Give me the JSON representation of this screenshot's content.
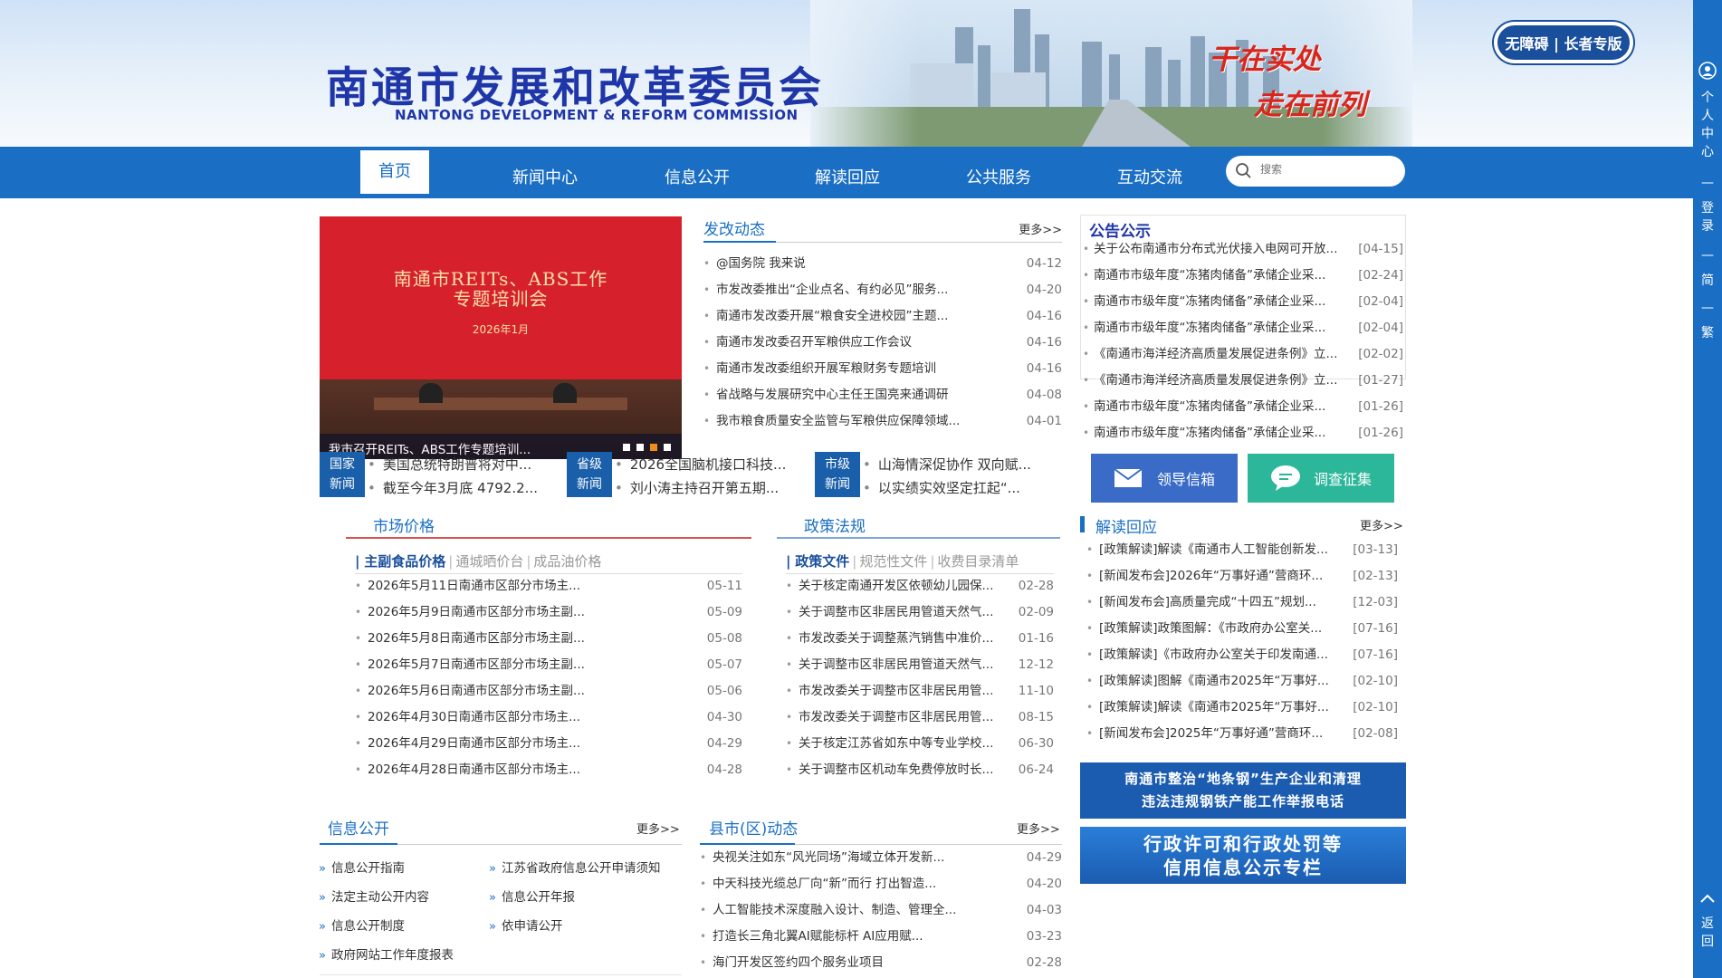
{
  "header": {
    "logo_cn": "南通市发展和改革委员会",
    "logo_en": "NANTONG DEVELOPMENT & REFORM COMMISSION",
    "slogan_line1": "干在实处",
    "slogan_line2": "走在前列",
    "accessibility": "无障碍 | 长者专版"
  },
  "right_bar": {
    "user_center": "个人中心",
    "login": "登录",
    "simplified": "简",
    "traditional": "繁",
    "back": "返回"
  },
  "nav": {
    "items": [
      "首页",
      "新闻中心",
      "信息公开",
      "解读回应",
      "公共服务",
      "互动交流"
    ],
    "search_placeholder": "搜索"
  },
  "carousel": {
    "screen_title_1": "南通市REITs、ABS工作",
    "screen_title_2": "专题培训会",
    "screen_year": "2026年1月",
    "caption": "我市召开REITs、ABS工作专题培训..."
  },
  "fagai": {
    "title": "发改动态",
    "more": "更多>>",
    "items": [
      {
        "t": "@国务院 我来说",
        "d": "04-12"
      },
      {
        "t": "市发改委推出“企业点名、有约必见”服务...",
        "d": "04-20"
      },
      {
        "t": "南通市发改委开展“粮食安全进校园”主题...",
        "d": "04-16"
      },
      {
        "t": "南通市发改委召开军粮供应工作会议",
        "d": "04-16"
      },
      {
        "t": "南通市发改委组织开展军粮财务专题培训",
        "d": "04-16"
      },
      {
        "t": "省战略与发展研究中心主任王国亮来通调研",
        "d": "04-08"
      },
      {
        "t": "我市粮食质量安全监管与军粮供应保障领域...",
        "d": "04-01"
      }
    ]
  },
  "news_strip": [
    {
      "tag1": "国家",
      "tag2": "新闻",
      "line1": "美国总统特朗普将对中...",
      "line2": "截至今年3月底 4792.2..."
    },
    {
      "tag1": "省级",
      "tag2": "新闻",
      "line1": "2026全国脑机接口科技...",
      "line2": "刘小涛主持召开第五期..."
    },
    {
      "tag1": "市级",
      "tag2": "新闻",
      "line1": "山海情深促协作 双向赋...",
      "line2": "以实绩实效坚定扛起“..."
    }
  ],
  "market": {
    "title": "市场价格",
    "tabs": [
      "主副食品价格",
      "通城晒价台",
      "成品油价格"
    ],
    "items": [
      {
        "t": "2026年5月11日南通市区部分市场主...",
        "d": "05-11"
      },
      {
        "t": "2026年5月9日南通市区部分市场主副...",
        "d": "05-09"
      },
      {
        "t": "2026年5月8日南通市区部分市场主副...",
        "d": "05-08"
      },
      {
        "t": "2026年5月7日南通市区部分市场主副...",
        "d": "05-07"
      },
      {
        "t": "2026年5月6日南通市区部分市场主副...",
        "d": "05-06"
      },
      {
        "t": "2026年4月30日南通市区部分市场主...",
        "d": "04-30"
      },
      {
        "t": "2026年4月29日南通市区部分市场主...",
        "d": "04-29"
      },
      {
        "t": "2026年4月28日南通市区部分市场主...",
        "d": "04-28"
      }
    ]
  },
  "policy": {
    "title": "政策法规",
    "tabs": [
      "政策文件",
      "规范性文件",
      "收费目录清单"
    ],
    "items": [
      {
        "t": "关于核定南通开发区依顿幼儿园保...",
        "d": "02-28"
      },
      {
        "t": "关于调整市区非居民用管道天然气...",
        "d": "02-09"
      },
      {
        "t": "市发改委关于调整蒸汽销售中准价...",
        "d": "01-16"
      },
      {
        "t": "关于调整市区非居民用管道天然气...",
        "d": "12-12"
      },
      {
        "t": "市发改委关于调整市区非居民用管...",
        "d": "11-10"
      },
      {
        "t": "市发改委关于调整市区非居民用管...",
        "d": "08-15"
      },
      {
        "t": "关于核定江苏省如东中等专业学校...",
        "d": "06-30"
      },
      {
        "t": "关于调整市区机动车免费停放时长...",
        "d": "06-24"
      }
    ]
  },
  "notice": {
    "title": "公告公示",
    "items": [
      {
        "t": "关于公布南通市分布式光伏接入电网可开放...",
        "d": "[04-15]"
      },
      {
        "t": "南通市市级年度“冻猪肉储备”承储企业采...",
        "d": "[02-24]"
      },
      {
        "t": "南通市市级年度“冻猪肉储备”承储企业采...",
        "d": "[02-04]"
      },
      {
        "t": "南通市市级年度“冻猪肉储备”承储企业采...",
        "d": "[02-04]"
      },
      {
        "t": "《南通市海洋经济高质量发展促进条例》立...",
        "d": "[02-02]"
      },
      {
        "t": "《南通市海洋经济高质量发展促进条例》立...",
        "d": "[01-27]"
      },
      {
        "t": "南通市市级年度“冻猪肉储备”承储企业采...",
        "d": "[01-26]"
      },
      {
        "t": "南通市市级年度“冻猪肉储备”承储企业采...",
        "d": "[01-26]"
      }
    ]
  },
  "buttons": {
    "leader_mail": "领导信箱",
    "survey": "调查征集"
  },
  "interpret": {
    "title": "解读回应",
    "more": "更多>>",
    "items": [
      {
        "t": "[政策解读]解读《南通市人工智能创新发...",
        "d": "[03-13]"
      },
      {
        "t": "[新闻发布会]2026年“万事好通”营商环...",
        "d": "[02-13]"
      },
      {
        "t": "[新闻发布会]高质量完成“十四五”规划...",
        "d": "[12-03]"
      },
      {
        "t": "[政策解读]政策图解：《市政府办公室关...",
        "d": "[07-16]"
      },
      {
        "t": "[政策解读]《市政府办公室关于印发南通...",
        "d": "[07-16]"
      },
      {
        "t": "[政策解读]图解《南通市2025年“万事好...",
        "d": "[02-10]"
      },
      {
        "t": "[政策解读]解读《南通市2025年“万事好...",
        "d": "[02-10]"
      },
      {
        "t": "[新闻发布会]2025年“万事好通”营商环...",
        "d": "[02-08]"
      }
    ]
  },
  "promo": {
    "p1_line1": "南通市整治“地条钢”生产企业和清理",
    "p1_line2": "违法违规钢铁产能工作举报电话",
    "p2_line1": "行政许可和行政处罚等",
    "p2_line2": "信用信息公示专栏"
  },
  "info_open": {
    "title": "信息公开",
    "more": "更多>>",
    "links": [
      "信息公开指南",
      "江苏省政府信息公开申请须知",
      "法定主动公开内容",
      "信息公开年报",
      "信息公开制度",
      "依申请公开",
      "政府网站工作年度报表"
    ]
  },
  "county": {
    "title": "县市(区)动态",
    "more": "更多>>",
    "items": [
      {
        "t": "央视关注如东“风光同场”海域立体开发新...",
        "d": "04-29"
      },
      {
        "t": "中天科技光缆总厂向“新”而行 打出智造...",
        "d": "04-20"
      },
      {
        "t": "人工智能技术深度融入设计、制造、管理全...",
        "d": "04-03"
      },
      {
        "t": "打造长三角北翼AI赋能标杆 AI应用赋...",
        "d": "03-23"
      },
      {
        "t": "海门开发区签约四个服务业项目",
        "d": "02-28"
      }
    ]
  },
  "colors": {
    "primary": "#1a6fc4",
    "title_blue": "#1f36a8",
    "slogan_red": "#d9261c",
    "teal": "#2cb69a"
  }
}
